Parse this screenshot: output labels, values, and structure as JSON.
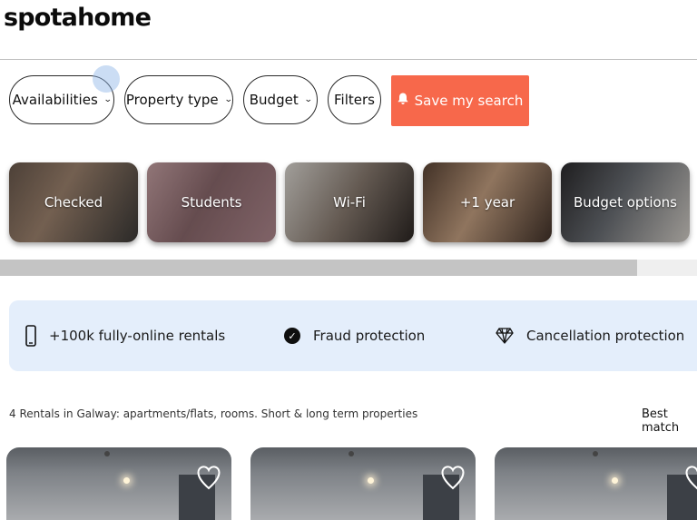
{
  "header": {
    "logo": "spotahome"
  },
  "filters": {
    "availabilities": "Availabilities",
    "property_type": "Property type",
    "budget": "Budget",
    "filters": "Filters",
    "save_search": "Save my search"
  },
  "colors": {
    "accent": "#f7684b",
    "benefits_bg": "#e4eefb"
  },
  "categories": [
    {
      "label": "Checked"
    },
    {
      "label": "Students"
    },
    {
      "label": "Wi-Fi"
    },
    {
      "label": "+1 year"
    },
    {
      "label": "Budget options"
    }
  ],
  "benefits": [
    {
      "label": "+100k fully-online rentals",
      "icon": "phone-icon"
    },
    {
      "label": "Fraud protection",
      "icon": "check-circle-icon"
    },
    {
      "label": "Cancellation protection",
      "icon": "diamond-icon"
    }
  ],
  "results": {
    "summary": "4 Rentals in Galway: apartments/flats, rooms. Short & long term properties",
    "sort": "Best match"
  }
}
